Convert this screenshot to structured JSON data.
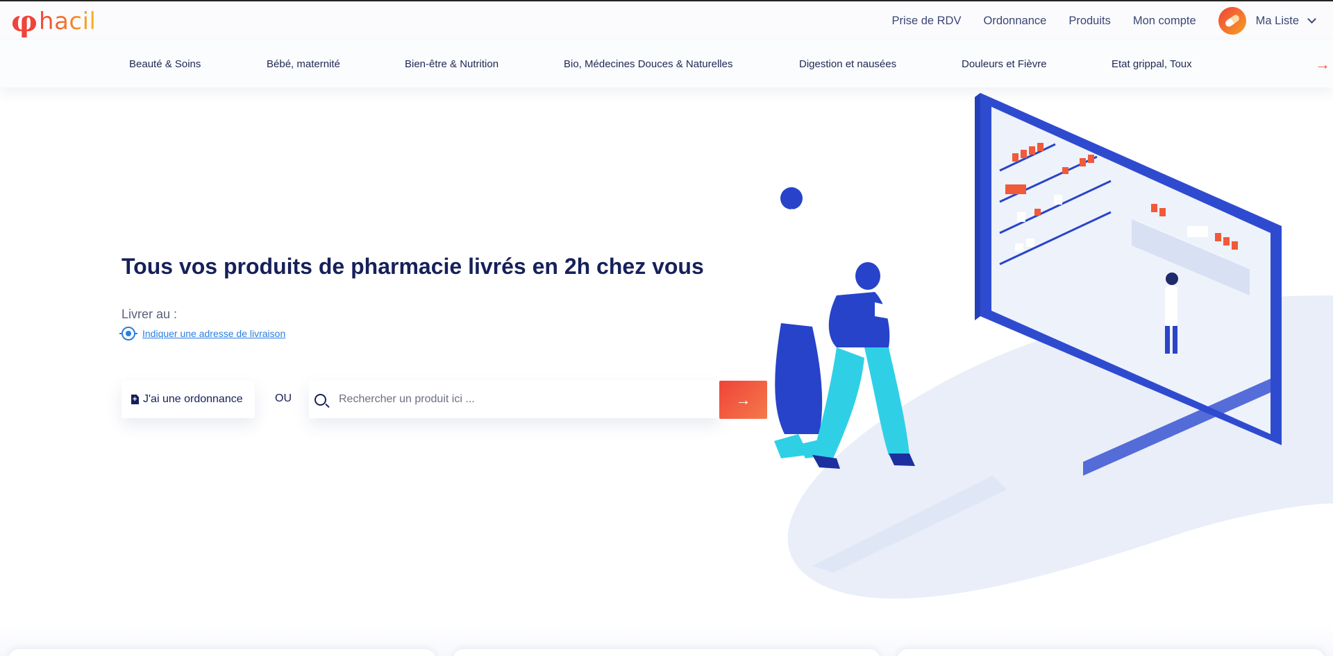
{
  "header": {
    "logo_text": "hacil",
    "nav": [
      "Prise de RDV",
      "Ordonnance",
      "Produits",
      "Mon compte"
    ],
    "my_list_label": "Ma Liste"
  },
  "categories": [
    "Beauté & Soins",
    "Bébé, maternité",
    "Bien-être & Nutrition",
    "Bio, Médecines Douces & Naturelles",
    "Digestion et nausées",
    "Douleurs et Fièvre",
    "Etat grippal, Toux"
  ],
  "hero": {
    "title": "Tous vos produits de pharmacie livrés en 2h chez vous",
    "deliver_label": "Livrer au :",
    "address_link": "Indiquer une adresse de livraison",
    "prescription_button": "J'ai une ordonnance",
    "or_label": "OU",
    "search_placeholder": "Rechercher un produit ici ..."
  },
  "colors": {
    "brand_gradient_start": "#f0433a",
    "brand_gradient_end": "#f6b624",
    "navy": "#16205a",
    "link_blue": "#2a7de1",
    "illustration_blue": "#3b5bdb"
  },
  "icons": {
    "category_next": "arrow-right-icon",
    "search_submit": "arrow-right-icon",
    "address": "location-target-icon",
    "prescription": "document-plus-icon",
    "search": "search-icon",
    "my_list": "pill-icon",
    "dropdown": "chevron-down-icon"
  }
}
